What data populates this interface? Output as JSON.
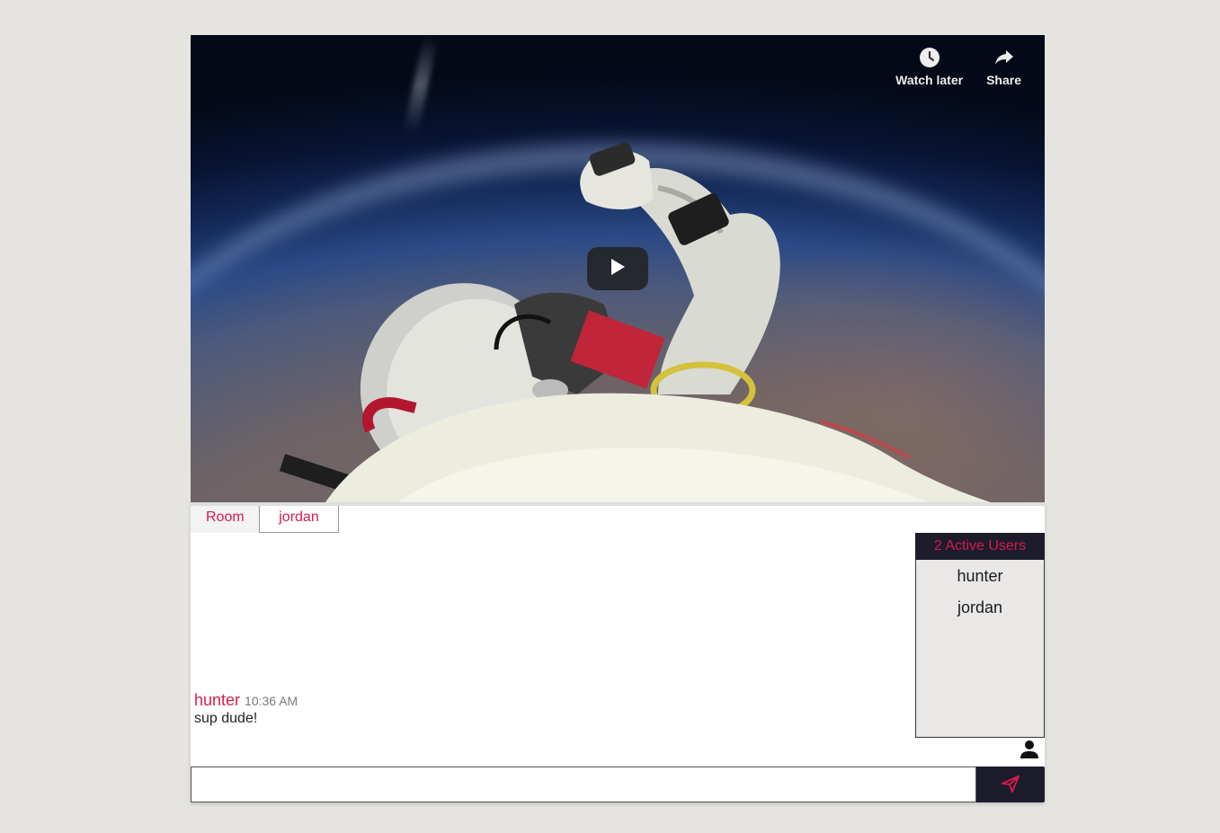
{
  "video": {
    "actions": [
      {
        "icon": "clock-icon",
        "label": "Watch later"
      },
      {
        "icon": "share-icon",
        "label": "Share"
      }
    ],
    "play_icon": "play-icon"
  },
  "chat": {
    "tabs": [
      {
        "label": "Room",
        "active": false
      },
      {
        "label": "jordan",
        "active": true
      }
    ],
    "messages": [
      {
        "user": "hunter",
        "time": "10:36 AM",
        "text": "sup dude!"
      }
    ],
    "active_users": {
      "title": "2 Active Users",
      "users": [
        "hunter",
        "jordan"
      ]
    },
    "input": {
      "value": "",
      "placeholder": ""
    },
    "send_icon": "send-icon",
    "person_icon": "person-icon"
  },
  "colors": {
    "accent": "#d81b4a",
    "dark": "#1c1c2b",
    "background": "#e5e4e1"
  }
}
